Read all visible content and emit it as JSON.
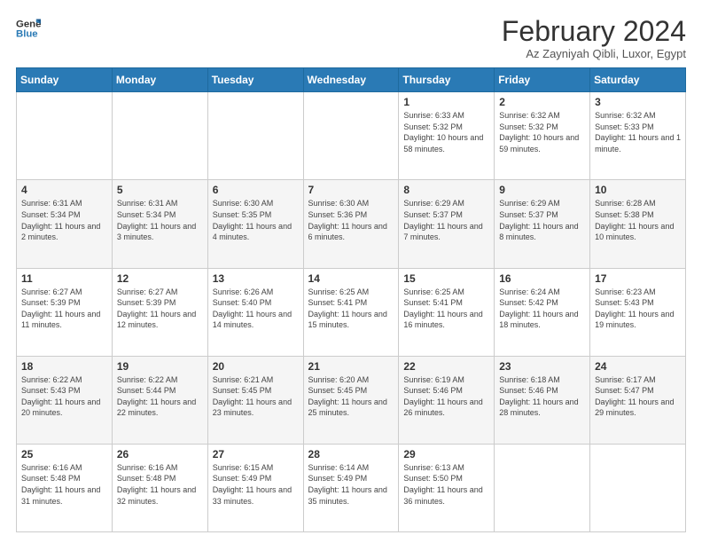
{
  "header": {
    "logo_line1": "General",
    "logo_line2": "Blue",
    "title": "February 2024",
    "subtitle": "Az Zayniyah Qibli, Luxor, Egypt"
  },
  "days_of_week": [
    "Sunday",
    "Monday",
    "Tuesday",
    "Wednesday",
    "Thursday",
    "Friday",
    "Saturday"
  ],
  "weeks": [
    [
      {
        "day": "",
        "sunrise": "",
        "sunset": "",
        "daylight": ""
      },
      {
        "day": "",
        "sunrise": "",
        "sunset": "",
        "daylight": ""
      },
      {
        "day": "",
        "sunrise": "",
        "sunset": "",
        "daylight": ""
      },
      {
        "day": "",
        "sunrise": "",
        "sunset": "",
        "daylight": ""
      },
      {
        "day": "1",
        "sunrise": "Sunrise: 6:33 AM",
        "sunset": "Sunset: 5:32 PM",
        "daylight": "Daylight: 10 hours and 58 minutes."
      },
      {
        "day": "2",
        "sunrise": "Sunrise: 6:32 AM",
        "sunset": "Sunset: 5:32 PM",
        "daylight": "Daylight: 10 hours and 59 minutes."
      },
      {
        "day": "3",
        "sunrise": "Sunrise: 6:32 AM",
        "sunset": "Sunset: 5:33 PM",
        "daylight": "Daylight: 11 hours and 1 minute."
      }
    ],
    [
      {
        "day": "4",
        "sunrise": "Sunrise: 6:31 AM",
        "sunset": "Sunset: 5:34 PM",
        "daylight": "Daylight: 11 hours and 2 minutes."
      },
      {
        "day": "5",
        "sunrise": "Sunrise: 6:31 AM",
        "sunset": "Sunset: 5:34 PM",
        "daylight": "Daylight: 11 hours and 3 minutes."
      },
      {
        "day": "6",
        "sunrise": "Sunrise: 6:30 AM",
        "sunset": "Sunset: 5:35 PM",
        "daylight": "Daylight: 11 hours and 4 minutes."
      },
      {
        "day": "7",
        "sunrise": "Sunrise: 6:30 AM",
        "sunset": "Sunset: 5:36 PM",
        "daylight": "Daylight: 11 hours and 6 minutes."
      },
      {
        "day": "8",
        "sunrise": "Sunrise: 6:29 AM",
        "sunset": "Sunset: 5:37 PM",
        "daylight": "Daylight: 11 hours and 7 minutes."
      },
      {
        "day": "9",
        "sunrise": "Sunrise: 6:29 AM",
        "sunset": "Sunset: 5:37 PM",
        "daylight": "Daylight: 11 hours and 8 minutes."
      },
      {
        "day": "10",
        "sunrise": "Sunrise: 6:28 AM",
        "sunset": "Sunset: 5:38 PM",
        "daylight": "Daylight: 11 hours and 10 minutes."
      }
    ],
    [
      {
        "day": "11",
        "sunrise": "Sunrise: 6:27 AM",
        "sunset": "Sunset: 5:39 PM",
        "daylight": "Daylight: 11 hours and 11 minutes."
      },
      {
        "day": "12",
        "sunrise": "Sunrise: 6:27 AM",
        "sunset": "Sunset: 5:39 PM",
        "daylight": "Daylight: 11 hours and 12 minutes."
      },
      {
        "day": "13",
        "sunrise": "Sunrise: 6:26 AM",
        "sunset": "Sunset: 5:40 PM",
        "daylight": "Daylight: 11 hours and 14 minutes."
      },
      {
        "day": "14",
        "sunrise": "Sunrise: 6:25 AM",
        "sunset": "Sunset: 5:41 PM",
        "daylight": "Daylight: 11 hours and 15 minutes."
      },
      {
        "day": "15",
        "sunrise": "Sunrise: 6:25 AM",
        "sunset": "Sunset: 5:41 PM",
        "daylight": "Daylight: 11 hours and 16 minutes."
      },
      {
        "day": "16",
        "sunrise": "Sunrise: 6:24 AM",
        "sunset": "Sunset: 5:42 PM",
        "daylight": "Daylight: 11 hours and 18 minutes."
      },
      {
        "day": "17",
        "sunrise": "Sunrise: 6:23 AM",
        "sunset": "Sunset: 5:43 PM",
        "daylight": "Daylight: 11 hours and 19 minutes."
      }
    ],
    [
      {
        "day": "18",
        "sunrise": "Sunrise: 6:22 AM",
        "sunset": "Sunset: 5:43 PM",
        "daylight": "Daylight: 11 hours and 20 minutes."
      },
      {
        "day": "19",
        "sunrise": "Sunrise: 6:22 AM",
        "sunset": "Sunset: 5:44 PM",
        "daylight": "Daylight: 11 hours and 22 minutes."
      },
      {
        "day": "20",
        "sunrise": "Sunrise: 6:21 AM",
        "sunset": "Sunset: 5:45 PM",
        "daylight": "Daylight: 11 hours and 23 minutes."
      },
      {
        "day": "21",
        "sunrise": "Sunrise: 6:20 AM",
        "sunset": "Sunset: 5:45 PM",
        "daylight": "Daylight: 11 hours and 25 minutes."
      },
      {
        "day": "22",
        "sunrise": "Sunrise: 6:19 AM",
        "sunset": "Sunset: 5:46 PM",
        "daylight": "Daylight: 11 hours and 26 minutes."
      },
      {
        "day": "23",
        "sunrise": "Sunrise: 6:18 AM",
        "sunset": "Sunset: 5:46 PM",
        "daylight": "Daylight: 11 hours and 28 minutes."
      },
      {
        "day": "24",
        "sunrise": "Sunrise: 6:17 AM",
        "sunset": "Sunset: 5:47 PM",
        "daylight": "Daylight: 11 hours and 29 minutes."
      }
    ],
    [
      {
        "day": "25",
        "sunrise": "Sunrise: 6:16 AM",
        "sunset": "Sunset: 5:48 PM",
        "daylight": "Daylight: 11 hours and 31 minutes."
      },
      {
        "day": "26",
        "sunrise": "Sunrise: 6:16 AM",
        "sunset": "Sunset: 5:48 PM",
        "daylight": "Daylight: 11 hours and 32 minutes."
      },
      {
        "day": "27",
        "sunrise": "Sunrise: 6:15 AM",
        "sunset": "Sunset: 5:49 PM",
        "daylight": "Daylight: 11 hours and 33 minutes."
      },
      {
        "day": "28",
        "sunrise": "Sunrise: 6:14 AM",
        "sunset": "Sunset: 5:49 PM",
        "daylight": "Daylight: 11 hours and 35 minutes."
      },
      {
        "day": "29",
        "sunrise": "Sunrise: 6:13 AM",
        "sunset": "Sunset: 5:50 PM",
        "daylight": "Daylight: 11 hours and 36 minutes."
      },
      {
        "day": "",
        "sunrise": "",
        "sunset": "",
        "daylight": ""
      },
      {
        "day": "",
        "sunrise": "",
        "sunset": "",
        "daylight": ""
      }
    ]
  ]
}
